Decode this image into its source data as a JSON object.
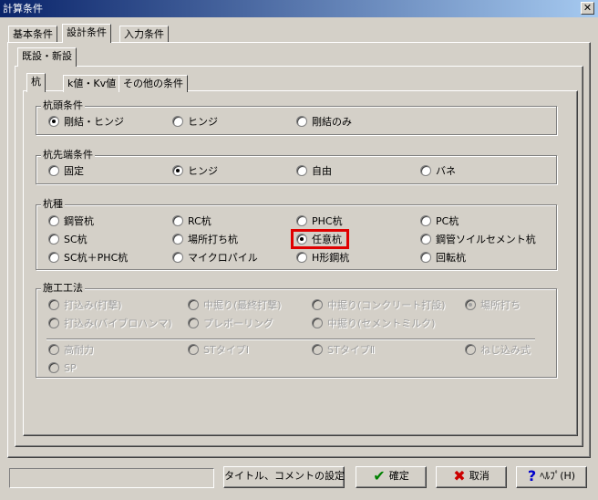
{
  "window": {
    "title": "計算条件",
    "close": "✕"
  },
  "top_tabs": [
    "基本条件",
    "設計条件",
    "入力条件"
  ],
  "sub_tab": "既設・新設",
  "inner_tabs": [
    "杭",
    "k値・Kv値",
    "その他の条件"
  ],
  "groups": {
    "pile_head": {
      "title": "杭頭条件",
      "options": [
        "剛結・ヒンジ",
        "ヒンジ",
        "剛結のみ"
      ],
      "selected": "剛結・ヒンジ"
    },
    "pile_tip": {
      "title": "杭先端条件",
      "options": [
        "固定",
        "ヒンジ",
        "自由",
        "バネ"
      ],
      "selected": "ヒンジ"
    },
    "pile_type": {
      "title": "杭種",
      "options": [
        "鋼管杭",
        "RC杭",
        "PHC杭",
        "PC杭",
        "SC杭",
        "場所打ち杭",
        "任意杭",
        "鋼管ソイルセメント杭",
        "SC杭＋PHC杭",
        "マイクロパイル",
        "H形鋼杭",
        "回転杭"
      ],
      "selected": "任意杭"
    },
    "construction": {
      "title": "施工工法",
      "options": [
        "打込み(打撃)",
        "中掘り(最終打撃)",
        "中掘り(コンクリート打設)",
        "場所打ち",
        "打込み(バイブロハンマ)",
        "プレボーリング",
        "中掘り(セメントミルク)",
        "高耐力",
        "STタイプⅠ",
        "STタイプⅡ",
        "ねじ込み式",
        "SP"
      ],
      "selected": "場所打ち"
    }
  },
  "buttons": {
    "title_comment": "タイトル、コメントの設定",
    "ok": "確定",
    "cancel": "取消",
    "help": "ﾍﾙﾌﾟ(H)"
  },
  "colors": {
    "highlight": "#e00000",
    "ok_icon": "#008000",
    "cancel_icon": "#cc0000",
    "help_icon": "#0000cc"
  }
}
